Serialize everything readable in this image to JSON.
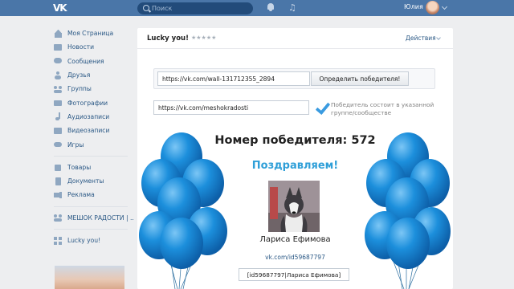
{
  "header": {
    "logo_text": "VK",
    "search_placeholder": "Поиск",
    "user_name": "Юлия"
  },
  "sidebar": {
    "items": [
      {
        "label": "Моя Страница",
        "icon": "home-icon"
      },
      {
        "label": "Новости",
        "icon": "news-icon"
      },
      {
        "label": "Сообщения",
        "icon": "messages-icon"
      },
      {
        "label": "Друзья",
        "icon": "friends-icon"
      },
      {
        "label": "Группы",
        "icon": "groups-icon"
      },
      {
        "label": "Фотографии",
        "icon": "camera-icon"
      },
      {
        "label": "Аудиозаписи",
        "icon": "music-icon"
      },
      {
        "label": "Видеозаписи",
        "icon": "video-icon"
      },
      {
        "label": "Игры",
        "icon": "games-icon"
      }
    ],
    "items2": [
      {
        "label": "Товары",
        "icon": "goods-icon"
      },
      {
        "label": "Документы",
        "icon": "documents-icon"
      },
      {
        "label": "Реклама",
        "icon": "ads-icon"
      }
    ],
    "items3": [
      {
        "label": "МЕШОК РАДОСТИ | ..",
        "icon": "community-icon"
      }
    ],
    "items4": [
      {
        "label": "Lucky you!",
        "icon": "apps-icon"
      }
    ]
  },
  "app": {
    "title": "Lucky you!",
    "rating": "★★★★★",
    "actions_label": "Действия",
    "wall_url": "https://vk.com/wall-131712355_2894",
    "determine_button": "Определить победителя!",
    "group_url": "https://vk.com/meshokradosti",
    "condition_text": "Победитель состоит в указанной группе/сообществе",
    "winner_number_text": "Номер победителя: 572",
    "congrats_text": "Поздравляем!",
    "winner_name": "Лариса Ефимова",
    "winner_link": "vk.com/id59687797",
    "winner_id_text": "[id59687797|Лариса Ефимова]"
  },
  "colors": {
    "header_bg": "#4a76a8",
    "link": "#2a5885",
    "accent": "#2f9fd8",
    "balloon": "#1c8fdc"
  }
}
